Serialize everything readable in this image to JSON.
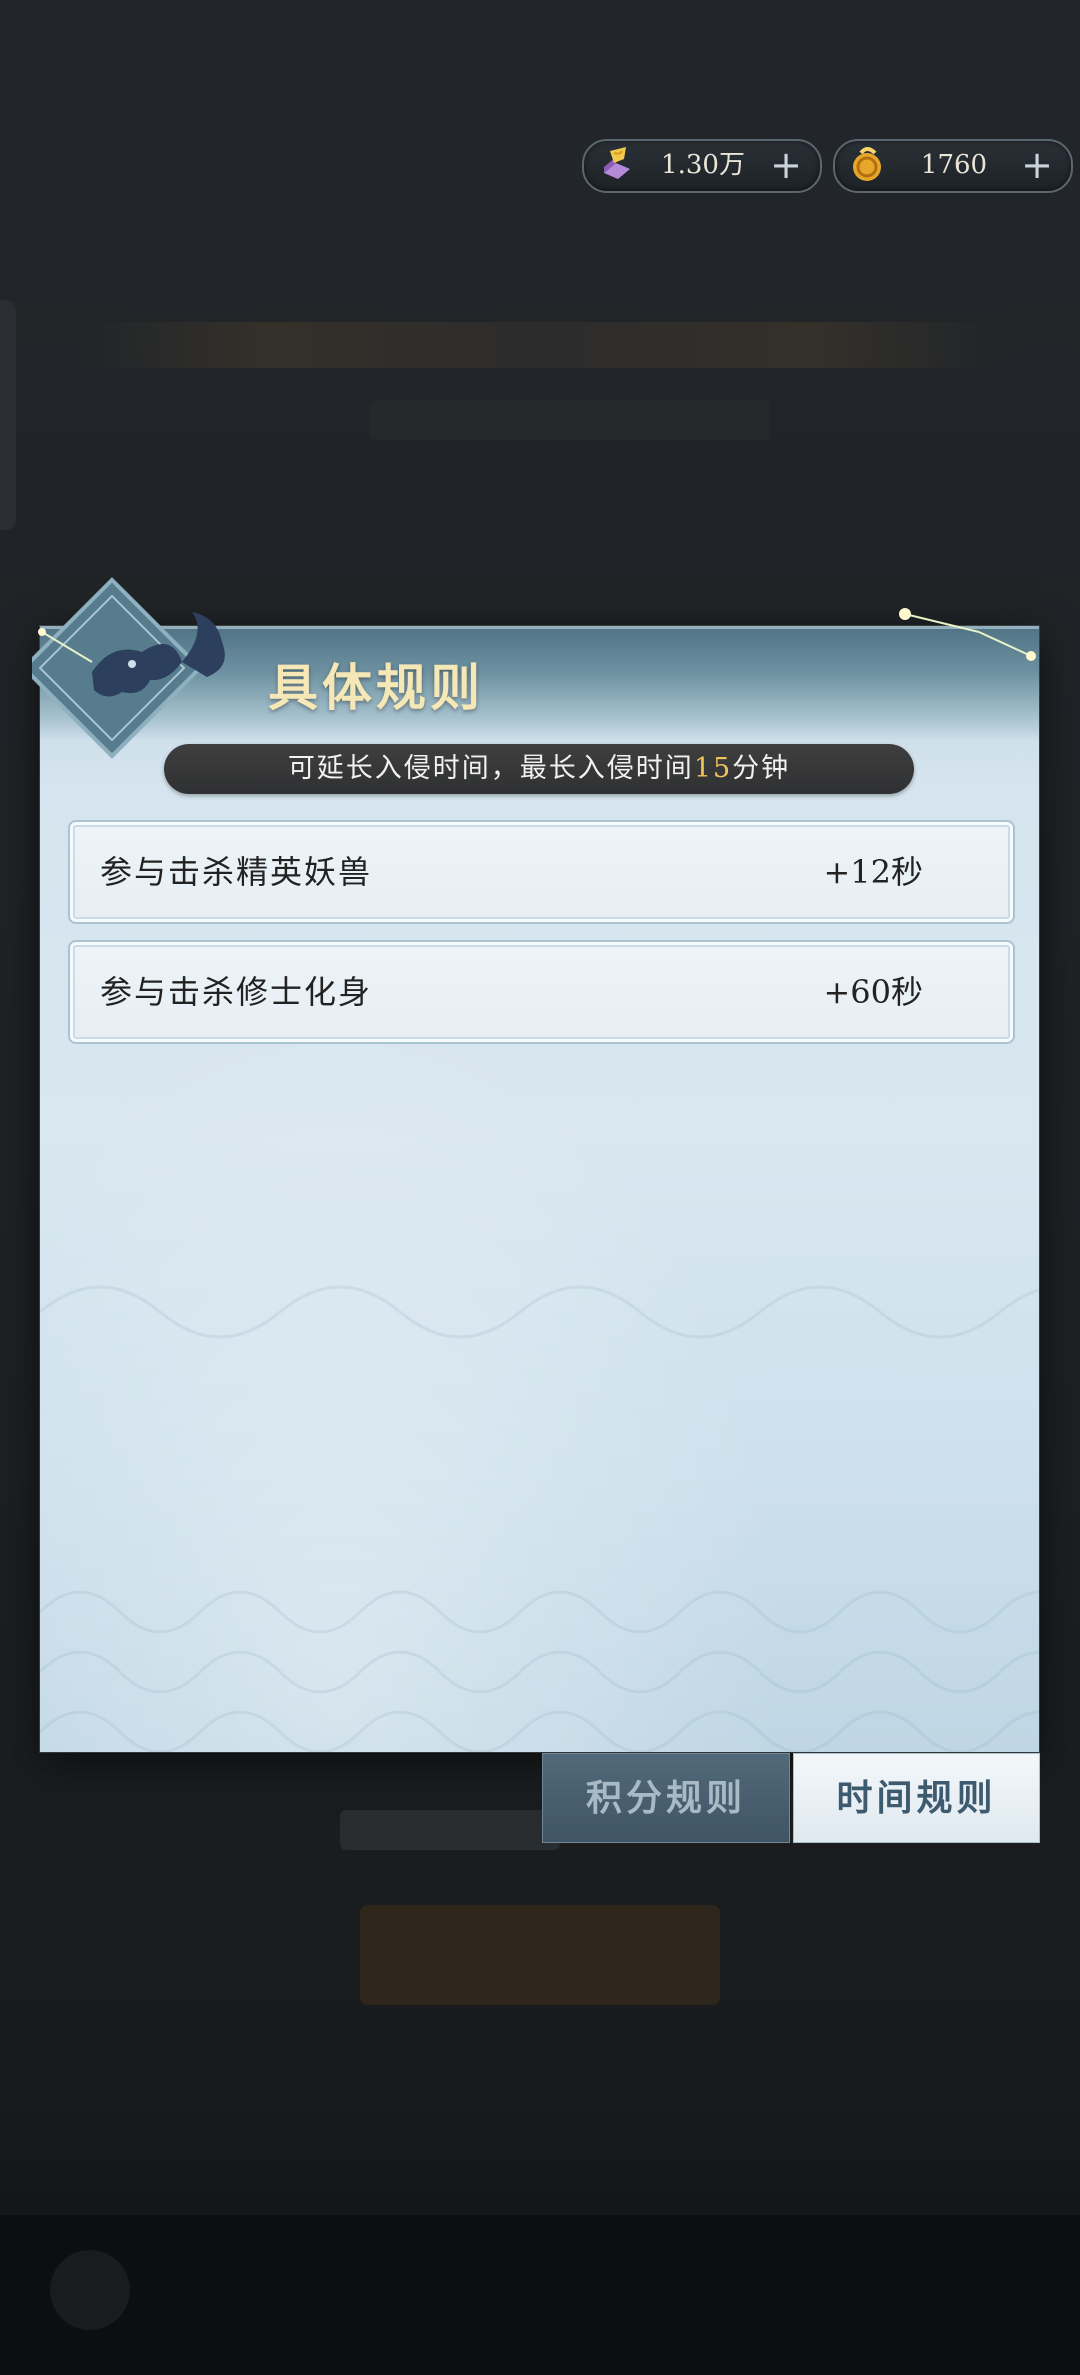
{
  "currency": [
    {
      "icon": "scroll-token-icon",
      "value": "1.30万"
    },
    {
      "icon": "gold-gourd-icon",
      "value": "1760"
    }
  ],
  "panel": {
    "title": "具体规则",
    "banner_prefix": "可延长入侵时间，最长入侵时间",
    "banner_highlight": "15",
    "banner_suffix": "分钟",
    "rules": [
      {
        "label": "参与击杀精英妖兽",
        "value": "+12秒"
      },
      {
        "label": "参与击杀修士化身",
        "value": "+60秒"
      }
    ]
  },
  "tabs": [
    {
      "label": "积分规则",
      "active": false
    },
    {
      "label": "时间规则",
      "active": true
    }
  ],
  "colors": {
    "title": "#f5e7b6",
    "highlight": "#f1c35a",
    "active_tab_text": "#3e5a6e"
  }
}
